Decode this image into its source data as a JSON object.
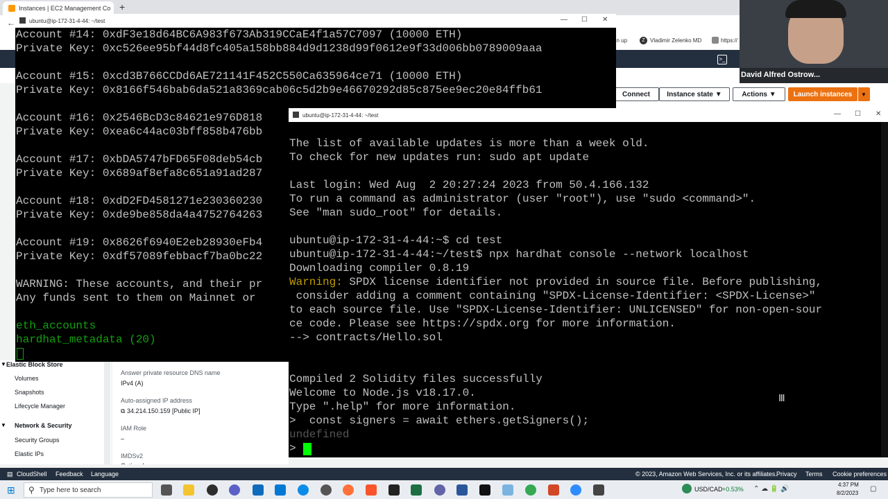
{
  "browser": {
    "tab_title": "Instances | EC2 Management Co",
    "new_tab": "+",
    "bookmarks": [
      "gn up",
      "Vladimir Zelenko MD",
      "https://"
    ]
  },
  "aws": {
    "buttons": {
      "connect": "Connect",
      "instance_state": "Instance state",
      "actions": "Actions",
      "launch": "Launch instances"
    },
    "sidebar": {
      "ebs_heading": "Elastic Block Store",
      "ebs_items": [
        "Volumes",
        "Snapshots",
        "Lifecycle Manager"
      ],
      "netsec_heading": "Network & Security",
      "netsec_items": [
        "Security Groups",
        "Elastic IPs"
      ]
    },
    "details": {
      "dns_label": "Answer private resource DNS name",
      "dns_value": "IPv4 (A)",
      "ip_label": "Auto-assigned IP address",
      "ip_value": "34.214.150.159 [Public IP]",
      "iam_label": "IAM Role",
      "iam_value": "–",
      "imds_label": "IMDSv2",
      "imds_value": "Optional"
    },
    "footer": {
      "cloudshell": "CloudShell",
      "feedback": "Feedback",
      "language": "Language",
      "copyright": "© 2023, Amazon Web Services, Inc. or its affiliates.",
      "privacy": "Privacy",
      "terms": "Terms",
      "cookies": "Cookie preferences"
    }
  },
  "terminal_back": {
    "title": "ubuntu@ip-172-31-4-44: ~/test",
    "lines": [
      "Account #14: 0xdF3e18d64BC6A983f673Ab319CCaE4f1a57C7097 (10000 ETH)",
      "Private Key: 0xc526ee95bf44d8fc405a158bb884d9d1238d99f0612e9f33d006bb0789009aaa",
      "",
      "Account #15: 0xcd3B766CCDd6AE721141F452C550Ca635964ce71 (10000 ETH)",
      "Private Key: 0x8166f546bab6da521a8369cab06c5d2b9e46670292d85c875ee9ec20e84ffb61",
      "",
      "Account #16: 0x2546BcD3c84621e976D818",
      "Private Key: 0xea6c44ac03bff858b476bb",
      "",
      "Account #17: 0xbDA5747bFD65F08deb54cb",
      "Private Key: 0x689af8efa8c651a91ad287",
      "",
      "Account #18: 0xdD2FD4581271e230360230",
      "Private Key: 0xde9be858da4a4752764263",
      "",
      "Account #19: 0x8626f6940E2eb28930eFb4",
      "Private Key: 0xdf57089febbacf7ba0bc22",
      "",
      "WARNING: These accounts, and their pr",
      "Any funds sent to them on Mainnet or"
    ],
    "green_lines": [
      "eth_accounts",
      "hardhat_metadata (20)"
    ]
  },
  "terminal_front": {
    "title": "ubuntu@ip-172-31-4-44: ~/test",
    "lines": [
      "The list of available updates is more than a week old.",
      "To check for new updates run: sudo apt update",
      "",
      "Last login: Wed Aug  2 20:27:24 2023 from 50.4.166.132",
      "To run a command as administrator (user \"root\"), use \"sudo <command>\".",
      "See \"man sudo_root\" for details.",
      "",
      "ubuntu@ip-172-31-4-44:~$ cd test",
      "ubuntu@ip-172-31-4-44:~/test$ npx hardhat console --network localhost",
      "Downloading compiler 0.8.19"
    ],
    "warning_label": "Warning:",
    "warning_rest": " SPDX license identifier not provided in source file. Before publishing,",
    "warning_lines": [
      " consider adding a comment containing \"SPDX-License-Identifier: <SPDX-License>\"",
      "to each source file. Use \"SPDX-License-Identifier: UNLICENSED\" for non-open-sour",
      "ce code. Please see https://spdx.org for more information.",
      "--> contracts/Hello.sol"
    ],
    "final_lines": [
      "Compiled 2 Solidity files successfully",
      "Welcome to Node.js v18.17.0.",
      "Type \".help\" for more information.",
      ">  const signers = await ethers.getSigners();"
    ],
    "undefined_line": "undefined",
    "prompt": "> "
  },
  "webcam": {
    "name": "David Alfred Ostrow..."
  },
  "taskbar": {
    "search_placeholder": "Type here to search",
    "currency": "USD/CAD",
    "change": "+0.53%",
    "time": "4:37 PM",
    "date": "8/2/2023"
  }
}
